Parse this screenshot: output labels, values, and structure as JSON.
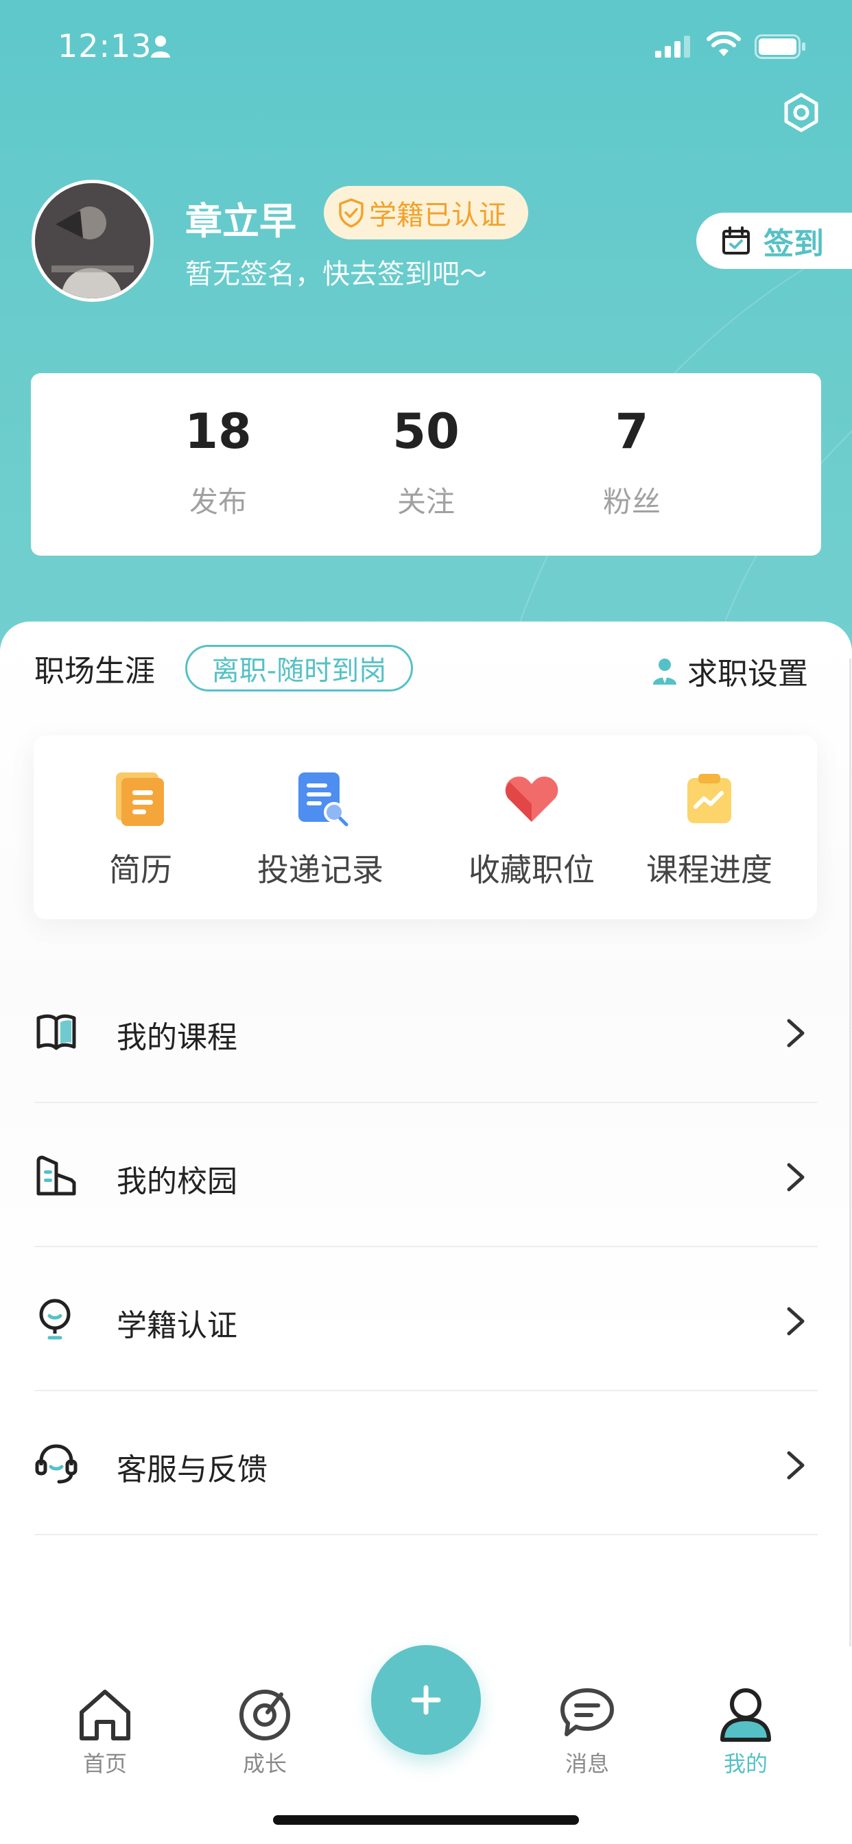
{
  "status_bar": {
    "time": "12:13"
  },
  "profile": {
    "name": "章立早",
    "badge": "学籍已认证",
    "signature": "暂无签名，快去签到吧～",
    "checkin_label": "签到"
  },
  "stats": [
    {
      "value": "18",
      "label": "发布"
    },
    {
      "value": "50",
      "label": "关注"
    },
    {
      "value": "7",
      "label": "粉丝"
    }
  ],
  "career": {
    "title": "职场生涯",
    "status_tag": "离职-随时到岗",
    "settings_label": "求职设置"
  },
  "quick_actions": [
    {
      "label": "简历",
      "icon": "resume-icon"
    },
    {
      "label": "投递记录",
      "icon": "delivery-record-icon"
    },
    {
      "label": "收藏职位",
      "icon": "heart-icon"
    },
    {
      "label": "课程进度",
      "icon": "course-progress-icon"
    }
  ],
  "menu": [
    {
      "label": "我的课程",
      "icon": "book-icon"
    },
    {
      "label": "我的校园",
      "icon": "campus-icon"
    },
    {
      "label": "学籍认证",
      "icon": "certification-icon"
    },
    {
      "label": "客服与反馈",
      "icon": "headset-icon"
    }
  ],
  "tabs": [
    {
      "label": "首页",
      "icon": "home-icon"
    },
    {
      "label": "成长",
      "icon": "growth-icon"
    },
    {
      "label": "消息",
      "icon": "message-icon"
    },
    {
      "label": "我的",
      "icon": "profile-icon",
      "active": true
    }
  ],
  "colors": {
    "accent": "#55c1c6",
    "header": "#62c9cb",
    "badge_text": "#f2a22c"
  }
}
